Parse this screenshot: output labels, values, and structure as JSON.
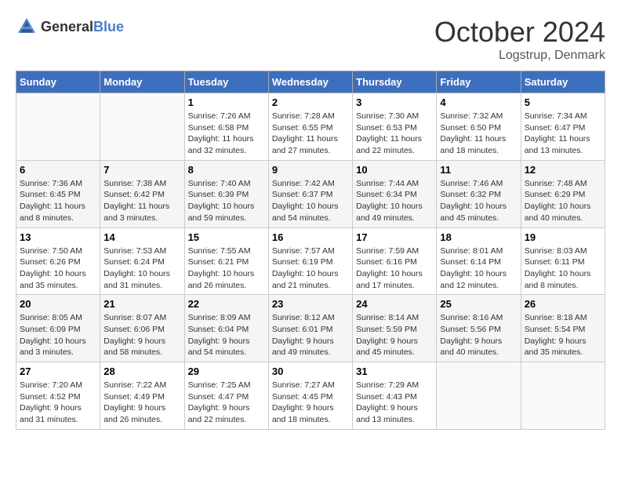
{
  "header": {
    "logo_general": "General",
    "logo_blue": "Blue",
    "title": "October 2024",
    "location": "Logstrup, Denmark"
  },
  "days_of_week": [
    "Sunday",
    "Monday",
    "Tuesday",
    "Wednesday",
    "Thursday",
    "Friday",
    "Saturday"
  ],
  "weeks": [
    [
      {
        "day": "",
        "sunrise": "",
        "sunset": "",
        "daylight": ""
      },
      {
        "day": "",
        "sunrise": "",
        "sunset": "",
        "daylight": ""
      },
      {
        "day": "1",
        "sunrise": "Sunrise: 7:26 AM",
        "sunset": "Sunset: 6:58 PM",
        "daylight": "Daylight: 11 hours and 32 minutes."
      },
      {
        "day": "2",
        "sunrise": "Sunrise: 7:28 AM",
        "sunset": "Sunset: 6:55 PM",
        "daylight": "Daylight: 11 hours and 27 minutes."
      },
      {
        "day": "3",
        "sunrise": "Sunrise: 7:30 AM",
        "sunset": "Sunset: 6:53 PM",
        "daylight": "Daylight: 11 hours and 22 minutes."
      },
      {
        "day": "4",
        "sunrise": "Sunrise: 7:32 AM",
        "sunset": "Sunset: 6:50 PM",
        "daylight": "Daylight: 11 hours and 18 minutes."
      },
      {
        "day": "5",
        "sunrise": "Sunrise: 7:34 AM",
        "sunset": "Sunset: 6:47 PM",
        "daylight": "Daylight: 11 hours and 13 minutes."
      }
    ],
    [
      {
        "day": "6",
        "sunrise": "Sunrise: 7:36 AM",
        "sunset": "Sunset: 6:45 PM",
        "daylight": "Daylight: 11 hours and 8 minutes."
      },
      {
        "day": "7",
        "sunrise": "Sunrise: 7:38 AM",
        "sunset": "Sunset: 6:42 PM",
        "daylight": "Daylight: 11 hours and 3 minutes."
      },
      {
        "day": "8",
        "sunrise": "Sunrise: 7:40 AM",
        "sunset": "Sunset: 6:39 PM",
        "daylight": "Daylight: 10 hours and 59 minutes."
      },
      {
        "day": "9",
        "sunrise": "Sunrise: 7:42 AM",
        "sunset": "Sunset: 6:37 PM",
        "daylight": "Daylight: 10 hours and 54 minutes."
      },
      {
        "day": "10",
        "sunrise": "Sunrise: 7:44 AM",
        "sunset": "Sunset: 6:34 PM",
        "daylight": "Daylight: 10 hours and 49 minutes."
      },
      {
        "day": "11",
        "sunrise": "Sunrise: 7:46 AM",
        "sunset": "Sunset: 6:32 PM",
        "daylight": "Daylight: 10 hours and 45 minutes."
      },
      {
        "day": "12",
        "sunrise": "Sunrise: 7:48 AM",
        "sunset": "Sunset: 6:29 PM",
        "daylight": "Daylight: 10 hours and 40 minutes."
      }
    ],
    [
      {
        "day": "13",
        "sunrise": "Sunrise: 7:50 AM",
        "sunset": "Sunset: 6:26 PM",
        "daylight": "Daylight: 10 hours and 35 minutes."
      },
      {
        "day": "14",
        "sunrise": "Sunrise: 7:53 AM",
        "sunset": "Sunset: 6:24 PM",
        "daylight": "Daylight: 10 hours and 31 minutes."
      },
      {
        "day": "15",
        "sunrise": "Sunrise: 7:55 AM",
        "sunset": "Sunset: 6:21 PM",
        "daylight": "Daylight: 10 hours and 26 minutes."
      },
      {
        "day": "16",
        "sunrise": "Sunrise: 7:57 AM",
        "sunset": "Sunset: 6:19 PM",
        "daylight": "Daylight: 10 hours and 21 minutes."
      },
      {
        "day": "17",
        "sunrise": "Sunrise: 7:59 AM",
        "sunset": "Sunset: 6:16 PM",
        "daylight": "Daylight: 10 hours and 17 minutes."
      },
      {
        "day": "18",
        "sunrise": "Sunrise: 8:01 AM",
        "sunset": "Sunset: 6:14 PM",
        "daylight": "Daylight: 10 hours and 12 minutes."
      },
      {
        "day": "19",
        "sunrise": "Sunrise: 8:03 AM",
        "sunset": "Sunset: 6:11 PM",
        "daylight": "Daylight: 10 hours and 8 minutes."
      }
    ],
    [
      {
        "day": "20",
        "sunrise": "Sunrise: 8:05 AM",
        "sunset": "Sunset: 6:09 PM",
        "daylight": "Daylight: 10 hours and 3 minutes."
      },
      {
        "day": "21",
        "sunrise": "Sunrise: 8:07 AM",
        "sunset": "Sunset: 6:06 PM",
        "daylight": "Daylight: 9 hours and 58 minutes."
      },
      {
        "day": "22",
        "sunrise": "Sunrise: 8:09 AM",
        "sunset": "Sunset: 6:04 PM",
        "daylight": "Daylight: 9 hours and 54 minutes."
      },
      {
        "day": "23",
        "sunrise": "Sunrise: 8:12 AM",
        "sunset": "Sunset: 6:01 PM",
        "daylight": "Daylight: 9 hours and 49 minutes."
      },
      {
        "day": "24",
        "sunrise": "Sunrise: 8:14 AM",
        "sunset": "Sunset: 5:59 PM",
        "daylight": "Daylight: 9 hours and 45 minutes."
      },
      {
        "day": "25",
        "sunrise": "Sunrise: 8:16 AM",
        "sunset": "Sunset: 5:56 PM",
        "daylight": "Daylight: 9 hours and 40 minutes."
      },
      {
        "day": "26",
        "sunrise": "Sunrise: 8:18 AM",
        "sunset": "Sunset: 5:54 PM",
        "daylight": "Daylight: 9 hours and 35 minutes."
      }
    ],
    [
      {
        "day": "27",
        "sunrise": "Sunrise: 7:20 AM",
        "sunset": "Sunset: 4:52 PM",
        "daylight": "Daylight: 9 hours and 31 minutes."
      },
      {
        "day": "28",
        "sunrise": "Sunrise: 7:22 AM",
        "sunset": "Sunset: 4:49 PM",
        "daylight": "Daylight: 9 hours and 26 minutes."
      },
      {
        "day": "29",
        "sunrise": "Sunrise: 7:25 AM",
        "sunset": "Sunset: 4:47 PM",
        "daylight": "Daylight: 9 hours and 22 minutes."
      },
      {
        "day": "30",
        "sunrise": "Sunrise: 7:27 AM",
        "sunset": "Sunset: 4:45 PM",
        "daylight": "Daylight: 9 hours and 18 minutes."
      },
      {
        "day": "31",
        "sunrise": "Sunrise: 7:29 AM",
        "sunset": "Sunset: 4:43 PM",
        "daylight": "Daylight: 9 hours and 13 minutes."
      },
      {
        "day": "",
        "sunrise": "",
        "sunset": "",
        "daylight": ""
      },
      {
        "day": "",
        "sunrise": "",
        "sunset": "",
        "daylight": ""
      }
    ]
  ]
}
